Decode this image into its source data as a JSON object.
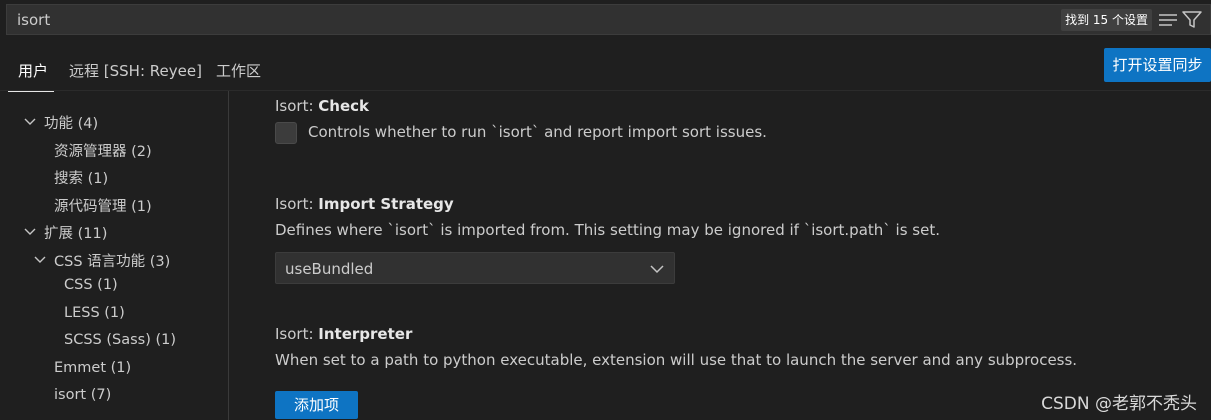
{
  "search": {
    "value": "isort",
    "result_count": "找到 15 个设置",
    "icons": [
      "clear-filter-lines-icon",
      "filter-icon"
    ]
  },
  "tabs": [
    {
      "label": "用户",
      "active": true
    },
    {
      "label": "远程 [SSH: Reyee]",
      "active": false
    },
    {
      "label": "工作区",
      "active": false
    }
  ],
  "sync_button": "打开设置同步",
  "tree": {
    "features": {
      "label": "功能",
      "count": "(4)"
    },
    "explorer": {
      "label": "资源管理器",
      "count": "(2)"
    },
    "search": {
      "label": "搜索",
      "count": "(1)"
    },
    "scm": {
      "label": "源代码管理",
      "count": "(1)"
    },
    "extensions": {
      "label": "扩展",
      "count": "(11)"
    },
    "css_lang": {
      "label": "CSS 语言功能",
      "count": "(3)"
    },
    "css": {
      "label": "CSS",
      "count": "(1)"
    },
    "less": {
      "label": "LESS",
      "count": "(1)"
    },
    "scss": {
      "label": "SCSS (Sass)",
      "count": "(1)"
    },
    "emmet": {
      "label": "Emmet",
      "count": "(1)"
    },
    "isort": {
      "label": "isort",
      "count": "(7)"
    }
  },
  "settings": {
    "check": {
      "prefix": "Isort: ",
      "name": "Check",
      "description": "Controls whether to run `isort` and report import sort issues.",
      "checked": false
    },
    "import_strategy": {
      "prefix": "Isort: ",
      "name": "Import Strategy",
      "description": "Defines where `isort` is imported from. This setting may be ignored if `isort.path` is set.",
      "value": "useBundled"
    },
    "interpreter": {
      "prefix": "Isort: ",
      "name": "Interpreter",
      "description": "When set to a path to python executable, extension will use that to launch the server and any subprocess.",
      "button": "添加项"
    }
  },
  "watermark": "CSDN @老郭不秃头",
  "colors": {
    "background": "#1f1f1f",
    "accent": "#0e74c3",
    "input_bg": "#313131"
  }
}
